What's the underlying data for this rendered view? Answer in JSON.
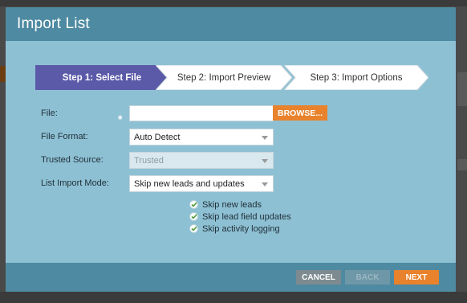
{
  "dialog": {
    "title": "Import List"
  },
  "steps": [
    {
      "label": "Step 1: Select File",
      "active": true
    },
    {
      "label": "Step 2: Import Preview",
      "active": false
    },
    {
      "label": "Step 3: Import Options",
      "active": false
    }
  ],
  "form": {
    "file_label": "File:",
    "required_mark": "*",
    "file_value": "",
    "browse_label": "BROWSE...",
    "format_label": "File Format:",
    "format_value": "Auto Detect",
    "trusted_label": "Trusted Source:",
    "trusted_value": "Trusted",
    "mode_label": "List Import Mode:",
    "mode_value": "Skip new leads and updates",
    "checks": [
      "Skip new leads",
      "Skip lead field updates",
      "Skip activity logging"
    ]
  },
  "footer": {
    "cancel_label": "CANCEL",
    "back_label": "BACK",
    "next_label": "NEXT"
  },
  "colors": {
    "accent": "#e8822c",
    "header": "#4e8aa1",
    "body": "#8ec0d4",
    "active_step": "#5b5aa8"
  }
}
